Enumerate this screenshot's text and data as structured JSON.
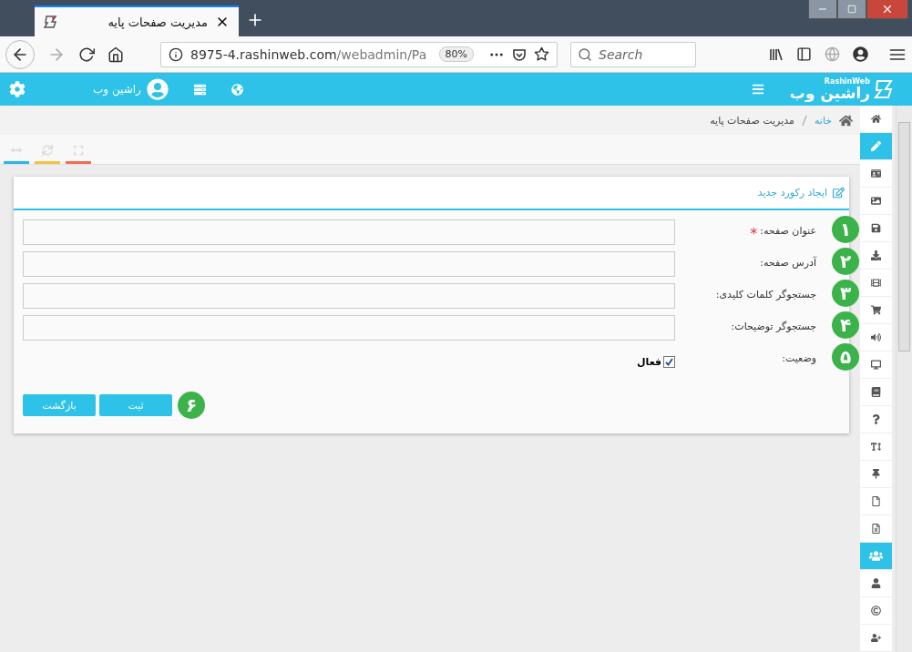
{
  "browser": {
    "tab_title": "مدیریت صفحات پایه",
    "url_host": "8975-4.rashinweb.com",
    "url_path": "/webadmin/Pa",
    "zoom": "80%",
    "search": {
      "placeholder": "Search"
    }
  },
  "header": {
    "logo_text": "راشین وب",
    "logo_latin": "RashinWeb",
    "user_name": "راشین وب"
  },
  "breadcrumb": [
    "خانه",
    "مدیریت صفحات پایه"
  ],
  "tools": [
    {
      "kind": "expand",
      "color": "#29b6e6"
    },
    {
      "kind": "refresh",
      "color": "#f5c342"
    },
    {
      "kind": "fullscreen",
      "color": "#f26d50"
    }
  ],
  "card": {
    "title": "ایجاد رکورد جدید",
    "fields": [
      {
        "kind": "text",
        "label": "عنوان صفحه:",
        "required_mark": "*",
        "badge": "۱"
      },
      {
        "kind": "text",
        "label": "آدرس صفحه:",
        "badge": "۲"
      },
      {
        "kind": "text",
        "label": "جستجوگر کلمات کلیدی:",
        "badge": "۳"
      },
      {
        "kind": "text",
        "label": "جستجوگر توضیحات:",
        "badge": "۴"
      },
      {
        "kind": "checkbox",
        "label": "وضعیت:",
        "badge": "۵",
        "option": "فعال",
        "checked": true
      }
    ],
    "buttons": [
      "ثبت",
      "بازگشت"
    ],
    "buttons_badge": "۶"
  },
  "sidebar": [
    {
      "kind": "home",
      "selected": false
    },
    {
      "kind": "pencil",
      "selected": true
    },
    {
      "kind": "idcard",
      "selected": false
    },
    {
      "kind": "image",
      "selected": false
    },
    {
      "kind": "save",
      "selected": false
    },
    {
      "kind": "download",
      "selected": false
    },
    {
      "kind": "film",
      "selected": false
    },
    {
      "kind": "cart",
      "selected": false
    },
    {
      "kind": "volume",
      "selected": false
    },
    {
      "kind": "desktop",
      "selected": false
    },
    {
      "kind": "book",
      "selected": false
    },
    {
      "kind": "question",
      "selected": false
    },
    {
      "kind": "textheight",
      "selected": false
    },
    {
      "kind": "pin",
      "selected": false
    },
    {
      "kind": "file",
      "selected": false
    },
    {
      "kind": "excel",
      "selected": false
    },
    {
      "kind": "users",
      "selected": true
    },
    {
      "kind": "user",
      "selected": false
    },
    {
      "kind": "copyright",
      "selected": false
    },
    {
      "kind": "userplus",
      "selected": false
    }
  ]
}
